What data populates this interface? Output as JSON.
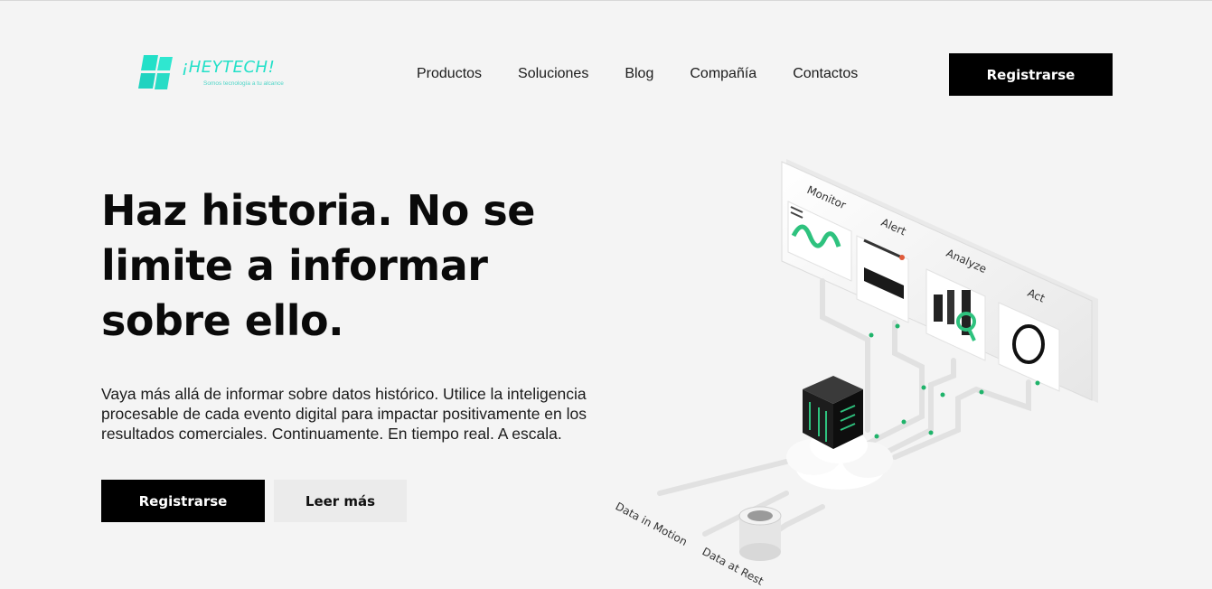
{
  "brand": {
    "name": "¡HEYTECH!",
    "tagline": "Somos tecnología a tu alcance",
    "color": "#22e0c8"
  },
  "nav": {
    "items": [
      "Productos",
      "Soluciones",
      "Blog",
      "Compañía",
      "Contactos"
    ],
    "register_label": "Registrarse"
  },
  "hero": {
    "title": "Haz historia. No se limite a informar sobre ello.",
    "subtitle": "Vaya más allá de informar sobre datos histórico. Utilice la inteligencia procesable de cada evento digital para impactar positivamente en los resultados comerciales. Continuamente. En tiempo real. A escala.",
    "primary_button": "Registrarse",
    "secondary_button": "Leer más"
  },
  "illustration": {
    "labels": {
      "monitor": "Monitor",
      "alert": "Alert",
      "analyze": "Analyze",
      "act": "Act",
      "data_motion": "Data in Motion",
      "data_rest": "Data at Rest"
    },
    "accent_color": "#1fb36a"
  }
}
